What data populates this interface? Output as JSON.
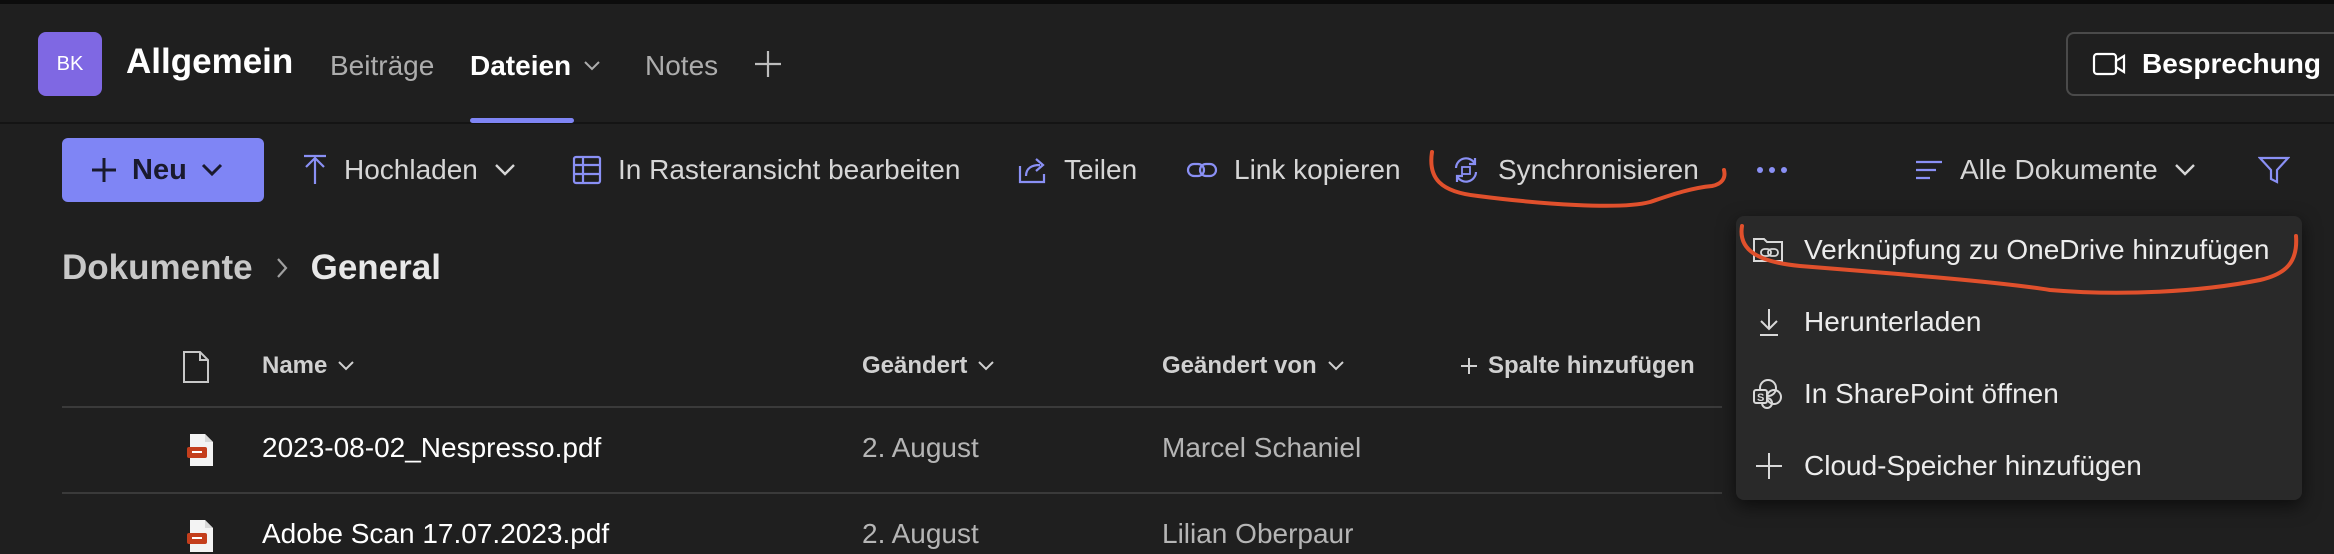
{
  "header": {
    "avatar_initials": "BK",
    "channel_name": "Allgemein",
    "tabs": [
      {
        "label": "Beiträge"
      },
      {
        "label": "Dateien"
      },
      {
        "label": "Notes"
      }
    ],
    "meeting_label": "Besprechung"
  },
  "toolbar": {
    "new_label": "Neu",
    "upload_label": "Hochladen",
    "grid_edit_label": "In Rasteransicht bearbeiten",
    "share_label": "Teilen",
    "copy_link_label": "Link kopieren",
    "sync_label": "Synchronisieren",
    "view_label": "Alle Dokumente"
  },
  "breadcrumb": {
    "root": "Dokumente",
    "current": "General"
  },
  "table": {
    "columns": {
      "name": "Name",
      "modified": "Geändert",
      "modified_by": "Geändert von",
      "add_column": "Spalte hinzufügen"
    },
    "rows": [
      {
        "name": "2023-08-02_Nespresso.pdf",
        "modified": "2. August",
        "modified_by": "Marcel Schaniel"
      },
      {
        "name": "Adobe Scan 17.07.2023.pdf",
        "modified": "2. August",
        "modified_by": "Lilian Oberpaur"
      }
    ]
  },
  "more_menu": {
    "items": [
      {
        "label": "Verknüpfung zu OneDrive hinzufügen",
        "icon": "onedrive-link-icon"
      },
      {
        "label": "Herunterladen",
        "icon": "download-icon"
      },
      {
        "label": "In SharePoint öffnen",
        "icon": "sharepoint-icon"
      },
      {
        "label": "Cloud-Speicher hinzufügen",
        "icon": "plus-icon"
      }
    ]
  },
  "colors": {
    "accent": "#7f85f5",
    "avatar": "#7f68e3",
    "annotation": "#e0502c",
    "pdf_red": "#c43e1c"
  }
}
